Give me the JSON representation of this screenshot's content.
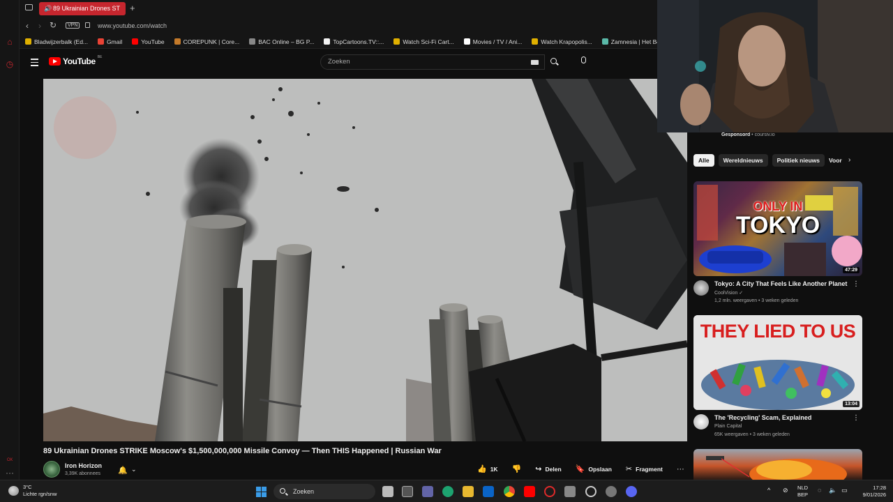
{
  "browser": {
    "tab_title": "89 Ukrainian Drones ST",
    "url": "www.youtube.com/watch",
    "vpn_label": "VPN",
    "bookmarks": [
      {
        "label": "Bladwijzerbalk (Ed...",
        "color": "#e0b000"
      },
      {
        "label": "Gmail",
        "color": "#ea4335"
      },
      {
        "label": "YouTube",
        "color": "#ff0000"
      },
      {
        "label": "COREPUNK | Core...",
        "color": "#c47a2a"
      },
      {
        "label": "BAC Online – BG P...",
        "color": "#888888"
      },
      {
        "label": "TopCartoons.TV::...",
        "color": "#f2f2f2"
      },
      {
        "label": "Watch Sci-Fi Cart...",
        "color": "#e0b000"
      },
      {
        "label": "Movies / TV / Ani...",
        "color": "#ffffff"
      },
      {
        "label": "Watch Krapopolis...",
        "color": "#e0b000"
      },
      {
        "label": "Zamnesia | Het Be...",
        "color": "#5ab9a8"
      }
    ]
  },
  "youtube": {
    "logo_text": "YouTube",
    "region": "BE",
    "search_placeholder": "Zoeken"
  },
  "video": {
    "title": "89 Ukrainian Drones STRIKE Moscow's $1,500,000,000 Missile Convoy — Then THIS Happened | Russian War",
    "channel": "Iron Horizon",
    "subscribers": "3,39K abonnees",
    "likes": "1K",
    "share_label": "Delen",
    "save_label": "Opslaan",
    "clip_label": "Fragment"
  },
  "sidebar": {
    "sponsored_label": "Gesponsord",
    "sponsored_domain": "coursiv.io",
    "chips": [
      "Alle",
      "Wereldnieuws",
      "Politiek nieuws",
      "Voor"
    ],
    "recommendations": [
      {
        "thumb_text_top": "ONLY IN",
        "thumb_text_main": "TOKYO",
        "duration": "47:29",
        "title": "Tokyo: A City That Feels Like Another Planet",
        "channel": "CoolVision",
        "meta": "1,2 mln. weergaven • 3 weken geleden"
      },
      {
        "thumb_text_main": "THEY LIED TO US",
        "duration": "13:04",
        "title": "The 'Recycling' Scam, Explained",
        "channel": "Plain Capital",
        "meta": "65K weergaven • 3 weken geleden"
      }
    ]
  },
  "taskbar": {
    "temperature": "3°C",
    "weather": "Lichte rgn/snw",
    "search_label": "Zoeken",
    "lang": "NLD",
    "lang_sub": "BEP",
    "time": "17:28",
    "date": "9/01/2026"
  },
  "colors": {
    "opera_red": "#c6262e",
    "youtube_red": "#ff0000",
    "background": "#0f0f0f"
  }
}
